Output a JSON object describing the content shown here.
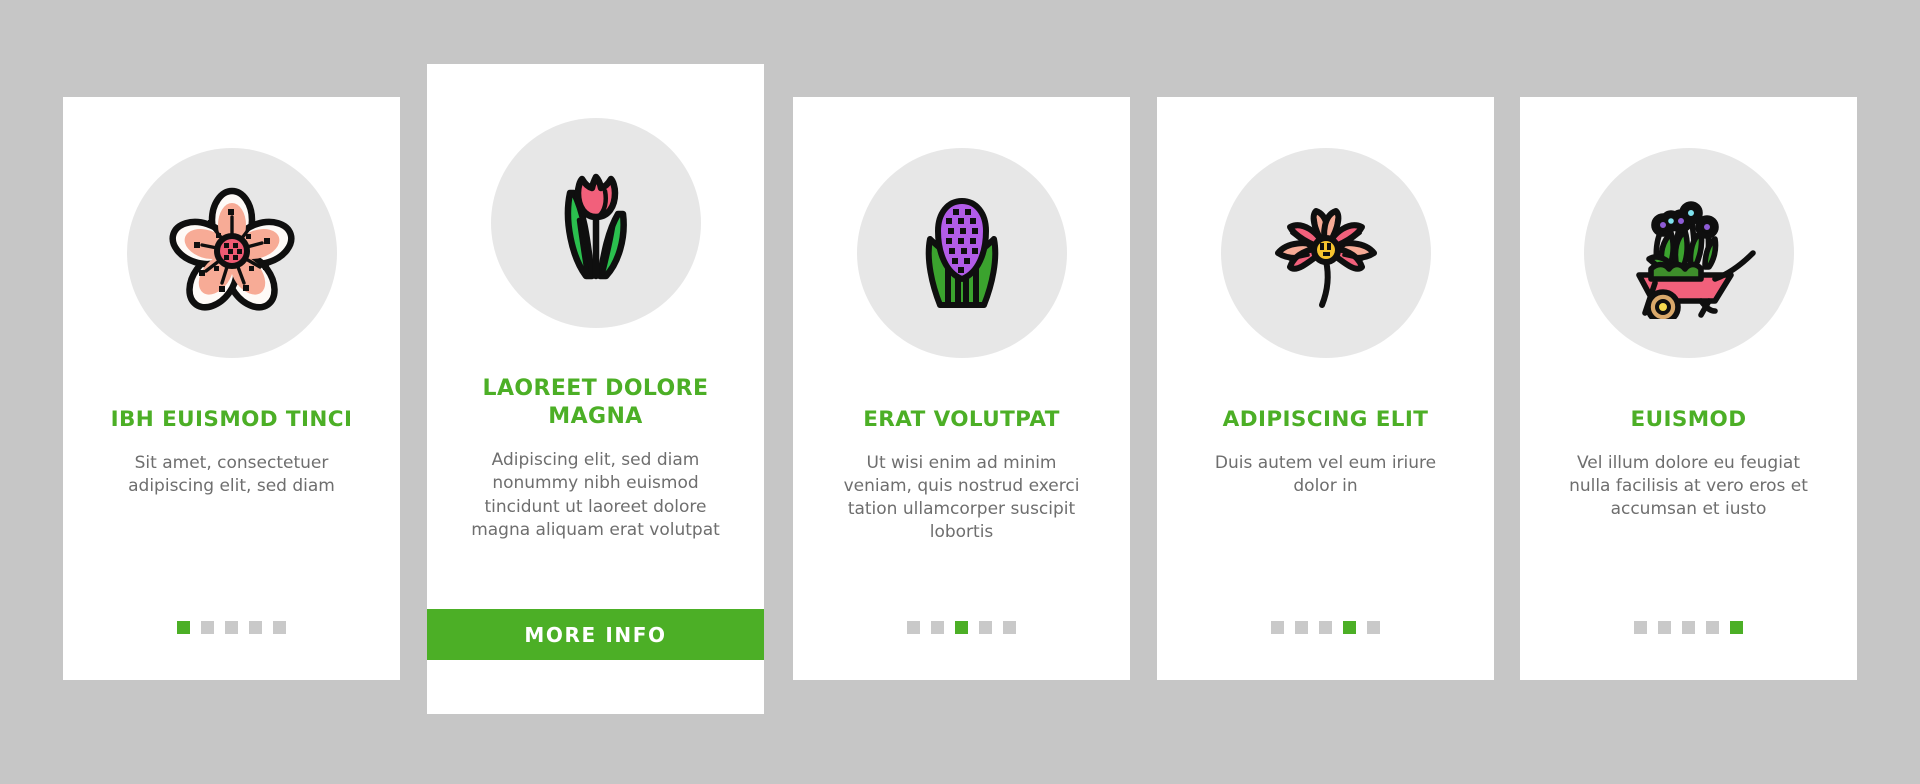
{
  "page": {
    "background_color": "#c6c6c6",
    "accent_color": "#4caf26",
    "muted_text_color": "#6e6e6e",
    "icon_circle_color": "#e7e7e7",
    "card_background": "#ffffff"
  },
  "cards": [
    {
      "icon": "cherry-blossom-flower-icon",
      "title": "IBH EUISMOD TINCI",
      "body": "Sit amet, consectetuer adipiscing elit, sed diam",
      "dots": {
        "total": 5,
        "active_index": 0
      },
      "featured": false
    },
    {
      "icon": "tulip-flower-icon",
      "title": "LAOREET DOLORE MAGNA",
      "body": "Adipiscing elit, sed diam nonummy nibh euismod tincidunt ut laoreet dolore magna aliquam erat volutpat",
      "cta_label": "MORE INFO",
      "featured": true
    },
    {
      "icon": "hyacinth-flower-icon",
      "title": "ERAT VOLUTPAT",
      "body": "Ut wisi enim ad minim veniam, quis nostrud exerci tation ullamcorper suscipit lobortis",
      "dots": {
        "total": 5,
        "active_index": 2
      },
      "featured": false
    },
    {
      "icon": "cosmos-flower-icon",
      "title": "ADIPISCING ELIT",
      "body": "Duis autem vel eum iriure dolor in",
      "dots": {
        "total": 5,
        "active_index": 3
      },
      "featured": false
    },
    {
      "icon": "wheelbarrow-with-flowers-icon",
      "title": "EUISMOD",
      "body": "Vel illum dolore eu feugiat nulla facilisis at vero eros et accumsan et iusto",
      "dots": {
        "total": 5,
        "active_index": 4
      },
      "featured": false
    }
  ]
}
